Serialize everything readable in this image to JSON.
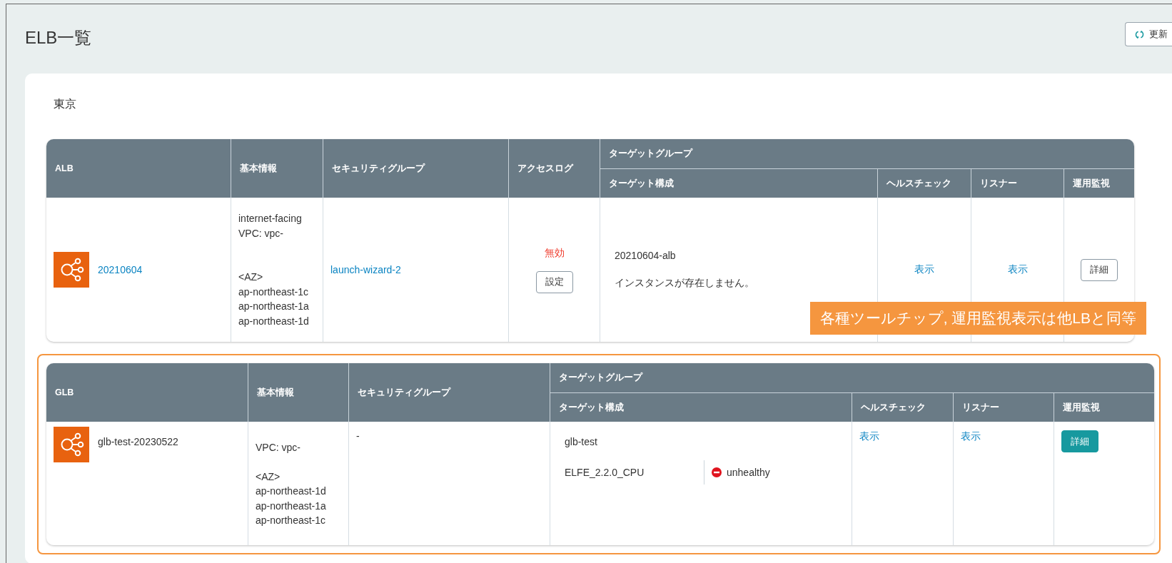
{
  "page": {
    "title": "ELB一覧",
    "refresh_button": "更新"
  },
  "region": "東京",
  "tables": [
    {
      "kind": "alb",
      "highlighted": false,
      "columns": [
        "ALB",
        "基本情報",
        "セキュリティグループ",
        "アクセスログ"
      ],
      "group_header": "ターゲットグループ",
      "group_columns": [
        "ターゲット構成",
        "ヘルスチェック",
        "リスナー",
        "運用監視"
      ],
      "annotation": "各種ツールチップ, 運用監視表示は他LBと同等",
      "rows": [
        {
          "name": "20210604",
          "name_is_link": true,
          "basic_info": [
            [
              "internet-facing",
              "VPC: vpc-"
            ],
            [
              "<AZ>",
              "ap-northeast-1c",
              "ap-northeast-1a",
              "ap-northeast-1d"
            ]
          ],
          "security_group": "launch-wizard-2",
          "security_group_is_link": true,
          "access_log": {
            "status": "無効",
            "enabled": false,
            "button": "設定"
          },
          "target": {
            "group": "20210604-alb",
            "message": "インスタンスが存在しません。"
          },
          "health_check": "表示",
          "listener": "表示",
          "monitoring": {
            "label": "詳細",
            "primary": false
          }
        }
      ]
    },
    {
      "kind": "glb",
      "highlighted": true,
      "columns": [
        "GLB",
        "基本情報",
        "セキュリティグループ"
      ],
      "group_header": "ターゲットグループ",
      "group_columns": [
        "ターゲット構成",
        "ヘルスチェック",
        "リスナー",
        "運用監視"
      ],
      "rows": [
        {
          "name": "glb-test-20230522",
          "name_is_link": false,
          "basic_info": [
            [
              "VPC: vpc-"
            ],
            [
              "<AZ>",
              "ap-northeast-1d",
              "ap-northeast-1a",
              "ap-northeast-1c"
            ]
          ],
          "security_group": "-",
          "security_group_is_link": false,
          "target": {
            "group": "glb-test",
            "targets": [
              {
                "name": "ELFE_2.2.0_CPU",
                "health": "unhealthy",
                "healthy": false
              }
            ]
          },
          "health_check": "表示",
          "listener": "表示",
          "monitoring": {
            "label": "詳細",
            "primary": true
          }
        }
      ]
    }
  ]
}
